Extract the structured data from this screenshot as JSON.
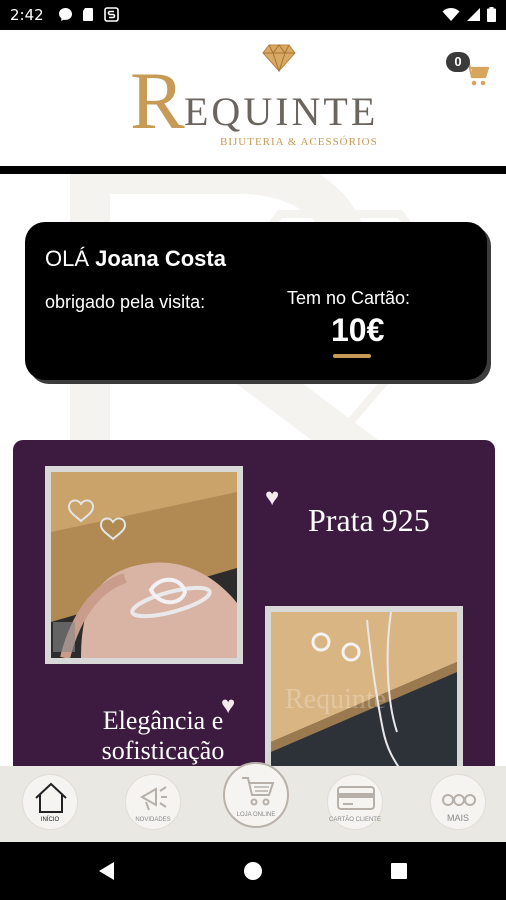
{
  "status_bar": {
    "time": "2:42"
  },
  "header": {
    "logo_initial": "R",
    "logo_brand": "EQUINTE",
    "logo_tagline": "BIJUTERIA & ACESSÓRIOS",
    "cart_count": "0"
  },
  "card": {
    "greeting": "OLÁ",
    "user_name": "Joana Costa",
    "thanks": "obrigado pela visita:",
    "balance_label": "Tem no Cartão:",
    "balance_value": "10€"
  },
  "promo": {
    "title": "Prata 925",
    "subtitle": "Elegância e sofisticação"
  },
  "bottom_nav": {
    "items": [
      {
        "label": "INÍCIO",
        "icon": "home-icon"
      },
      {
        "label": "NOVIDADES",
        "icon": "megaphone-icon"
      },
      {
        "label": "LOJA ONLINE",
        "icon": "cart-icon"
      },
      {
        "label": "CARTÃO CLIENTE",
        "icon": "card-icon"
      },
      {
        "label": "MAIS",
        "icon": "more-icon"
      }
    ]
  },
  "colors": {
    "gold": "#c79a55",
    "purple": "#3d1a40",
    "nav_bg": "#eae8e3"
  }
}
